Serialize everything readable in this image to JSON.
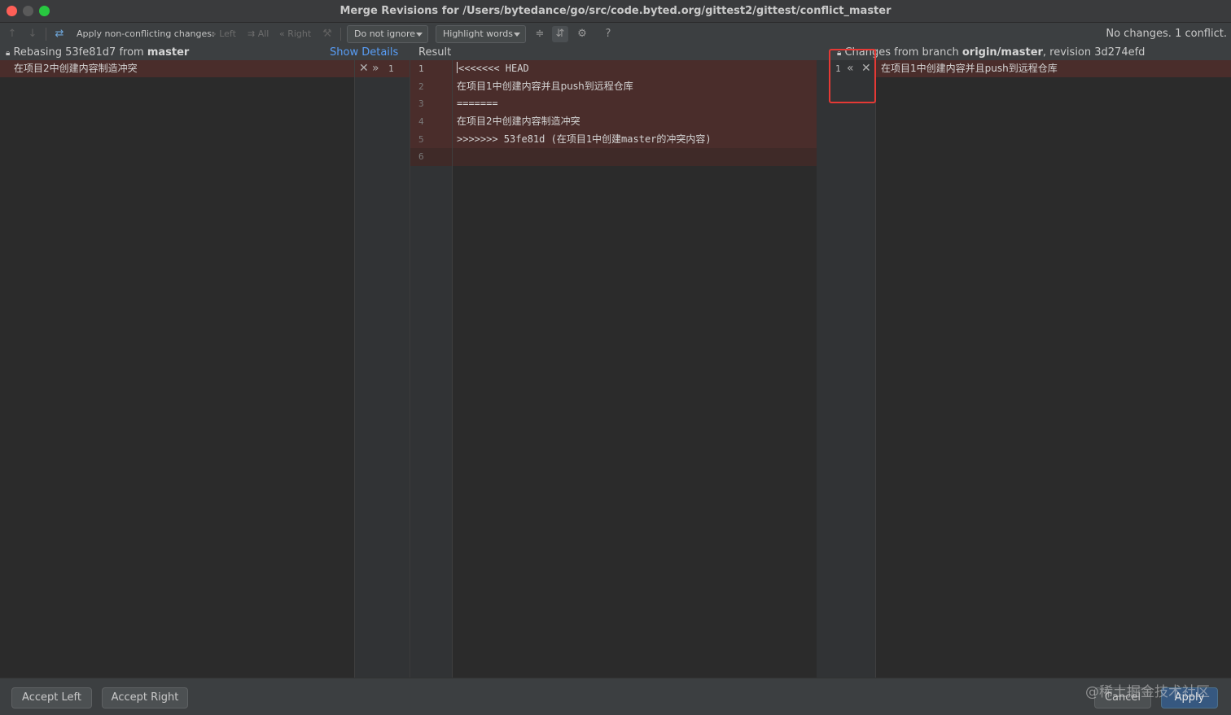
{
  "window": {
    "title": "Merge Revisions for /Users/bytedance/go/src/code.byted.org/gittest2/gittest/conflict_master"
  },
  "toolbar": {
    "apply_nonconflicting_label": "Apply non-conflicting changes:",
    "left_label": "Left",
    "all_label": "All",
    "right_label": "Right",
    "ignore_dropdown": "Do not ignore",
    "highlight_dropdown": "Highlight words",
    "help_label": "?",
    "status": "No changes. 1 conflict."
  },
  "header": {
    "left_prefix": "Rebasing 53fe81d7 from ",
    "left_branch": "master",
    "show_details": "Show Details",
    "result_label": "Result",
    "right_prefix": "Changes from branch ",
    "right_branch": "origin/master",
    "right_suffix": ", revision 3d274efd"
  },
  "left_pane": {
    "line_number": "1",
    "lines": [
      "在项目2中创建内容制造冲突"
    ]
  },
  "result_pane": {
    "lines": [
      {
        "num": "1",
        "text": "<<<<<<< HEAD"
      },
      {
        "num": "2",
        "text": "在项目1中创建内容并且push到远程仓库"
      },
      {
        "num": "3",
        "text": "======="
      },
      {
        "num": "4",
        "text": "在项目2中创建内容制造冲突"
      },
      {
        "num": "5",
        "text": ">>>>>>> 53fe81d (在项目1中创建master的冲突内容)"
      },
      {
        "num": "6",
        "text": ""
      }
    ]
  },
  "right_pane": {
    "line_number": "1",
    "lines": [
      "在项目1中创建内容并且push到远程仓库"
    ]
  },
  "footer": {
    "accept_left": "Accept Left",
    "accept_right": "Accept Right",
    "cancel": "Cancel",
    "apply": "Apply",
    "watermark": "@稀土掘金技术社区"
  },
  "colors": {
    "conflict_background": "#4a2d2b",
    "highlight_box": "#e53935",
    "link": "#589df6",
    "apply_button": "#365880"
  }
}
